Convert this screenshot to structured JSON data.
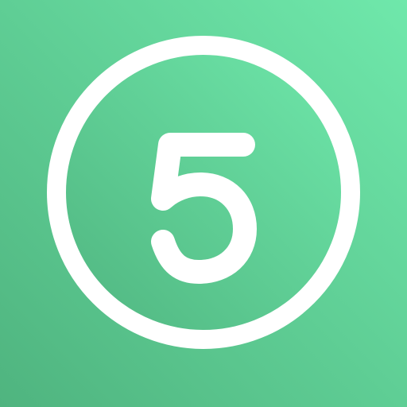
{
  "app_icon": {
    "digit": "5",
    "icon_name": "numeral-five-in-ring-icon",
    "colors": {
      "background_light": "#6fe8ab",
      "background_dark": "#4fb47f",
      "ring": "#ffffff",
      "digit": "#ffffff"
    }
  }
}
